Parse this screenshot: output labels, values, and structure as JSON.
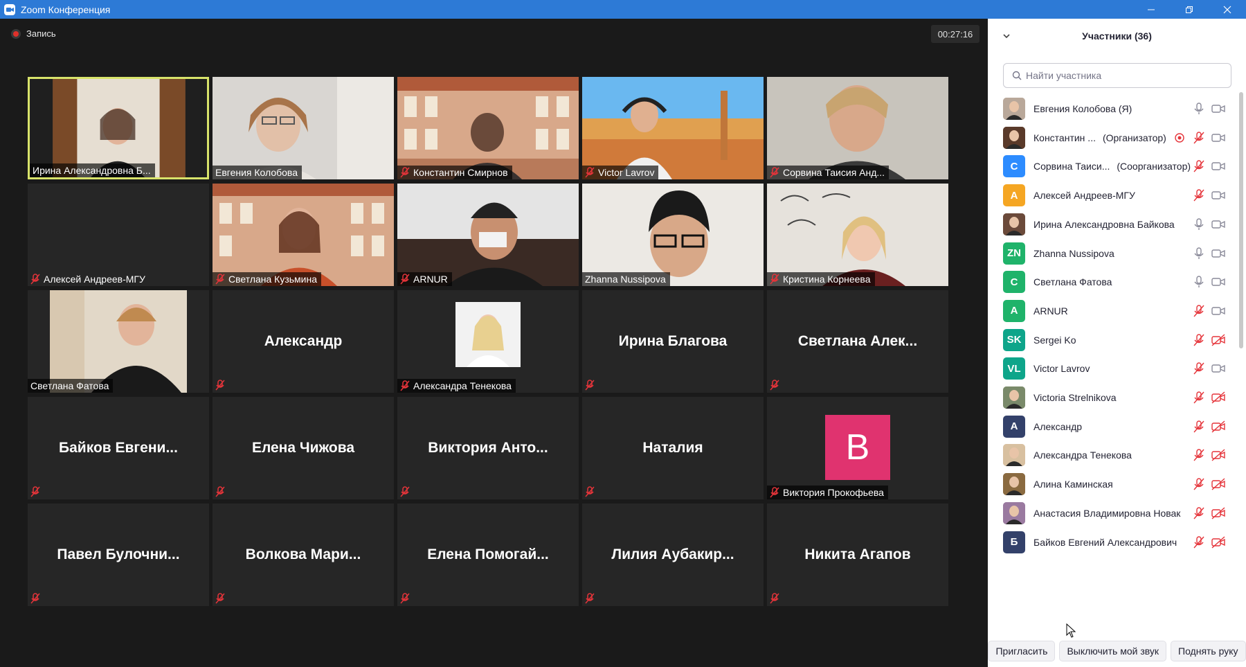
{
  "window": {
    "title": "Zoom Конференция"
  },
  "meeting": {
    "recording_label": "Запись",
    "timer": "00:27:16"
  },
  "tiles": [
    {
      "name": "Ирина Александровна Б...",
      "type": "video",
      "active": true,
      "muted": false
    },
    {
      "name": "Евгения Колобова",
      "type": "video",
      "muted": false
    },
    {
      "name": "Константин Смирнов",
      "type": "video",
      "muted": true
    },
    {
      "name": "Victor Lavrov",
      "type": "video",
      "muted": true
    },
    {
      "name": "Сорвина Таисия Анд...",
      "type": "video",
      "muted": true
    },
    {
      "name": "Алексей Андреев-МГУ",
      "type": "blank",
      "muted": true
    },
    {
      "name": "Светлана Кузьмина",
      "type": "video",
      "muted": true
    },
    {
      "name": "ARNUR",
      "type": "video",
      "muted": true
    },
    {
      "name": "Zhanna Nussipova",
      "type": "video",
      "muted": false
    },
    {
      "name": "Кристина Корнеева",
      "type": "video",
      "muted": true
    },
    {
      "name": "Светлана Фатова",
      "type": "photo",
      "muted": false
    },
    {
      "big": "Александр",
      "type": "name",
      "muted": true
    },
    {
      "name": "Александра Тенекова",
      "type": "photo",
      "muted": true
    },
    {
      "big": "Ирина Благова",
      "type": "name",
      "muted": true
    },
    {
      "big": "Светлана Алек...",
      "type": "name",
      "muted": true
    },
    {
      "big": "Байков Евгени...",
      "type": "name",
      "muted": true
    },
    {
      "big": "Елена Чижова",
      "type": "name",
      "muted": true
    },
    {
      "big": "Виктория Анто...",
      "type": "name",
      "muted": true
    },
    {
      "big": "Наталия",
      "type": "name",
      "muted": true
    },
    {
      "name": "Виктория Прокофьева",
      "letter": "В",
      "type": "letter",
      "muted": true
    },
    {
      "big": "Павел Булочни...",
      "type": "name",
      "muted": true
    },
    {
      "big": "Волкова Мари...",
      "type": "name",
      "muted": true
    },
    {
      "big": "Елена Помогай...",
      "type": "name",
      "muted": true
    },
    {
      "big": "Лилия Аубакир...",
      "type": "name",
      "muted": true
    },
    {
      "big": "Никита Агапов",
      "type": "name",
      "muted": true
    }
  ],
  "panel": {
    "title": "Участники (36)",
    "search_placeholder": "Найти участника",
    "participants": [
      {
        "name": "Евгения Колобова (Я)",
        "role": "",
        "avatar": "photo",
        "color": "#b9a89a",
        "mic": "on",
        "video": "on"
      },
      {
        "name": "Константин ...",
        "role": "(Организатор)",
        "avatar": "photo",
        "color": "#5a3a2a",
        "mic": "off",
        "video": "on",
        "rec": true
      },
      {
        "name": "Сорвина Таиси...",
        "role": "(Соорганизатор)",
        "avatar": "С",
        "color": "#2d8cff",
        "mic": "off",
        "video": "on"
      },
      {
        "name": "Алексей Андреев-МГУ",
        "role": "",
        "avatar": "А",
        "color": "#f5a623",
        "mic": "off",
        "video": "on"
      },
      {
        "name": "Ирина Александровна Байкова",
        "role": "",
        "avatar": "photo",
        "color": "#6b4a3a",
        "mic": "on",
        "video": "on"
      },
      {
        "name": "Zhanna Nussipova",
        "role": "",
        "avatar": "ZN",
        "color": "#1fb36a",
        "mic": "on",
        "video": "on"
      },
      {
        "name": "Светлана Фатова",
        "role": "",
        "avatar": "С",
        "color": "#1fb36a",
        "mic": "on",
        "video": "on"
      },
      {
        "name": "ARNUR",
        "role": "",
        "avatar": "A",
        "color": "#1fb36a",
        "mic": "off",
        "video": "on"
      },
      {
        "name": "Sergei Ko",
        "role": "",
        "avatar": "SK",
        "color": "#0ea58a",
        "mic": "off",
        "video": "off"
      },
      {
        "name": "Victor Lavrov",
        "role": "",
        "avatar": "VL",
        "color": "#0ea58a",
        "mic": "off",
        "video": "on"
      },
      {
        "name": "Victoria Strelnikova",
        "role": "",
        "avatar": "photo",
        "color": "#7a8a6a",
        "mic": "off",
        "video": "off"
      },
      {
        "name": "Александр",
        "role": "",
        "avatar": "А",
        "color": "#33416a",
        "mic": "off",
        "video": "off"
      },
      {
        "name": "Александра Тенекова",
        "role": "",
        "avatar": "photo",
        "color": "#d8c0a0",
        "mic": "off",
        "video": "off"
      },
      {
        "name": "Алина Каминская",
        "role": "",
        "avatar": "photo",
        "color": "#8a6a40",
        "mic": "off",
        "video": "off"
      },
      {
        "name": "Анастасия Владимировна Новак",
        "role": "",
        "avatar": "photo",
        "color": "#9a7aa0",
        "mic": "off",
        "video": "off"
      },
      {
        "name": "Байков Евгений Александрович",
        "role": "",
        "avatar": "Б",
        "color": "#33416a",
        "mic": "off",
        "video": "off"
      }
    ],
    "buttons": {
      "invite": "Пригласить",
      "mute_me": "Выключить мой звук",
      "raise_hand": "Поднять руку"
    }
  }
}
